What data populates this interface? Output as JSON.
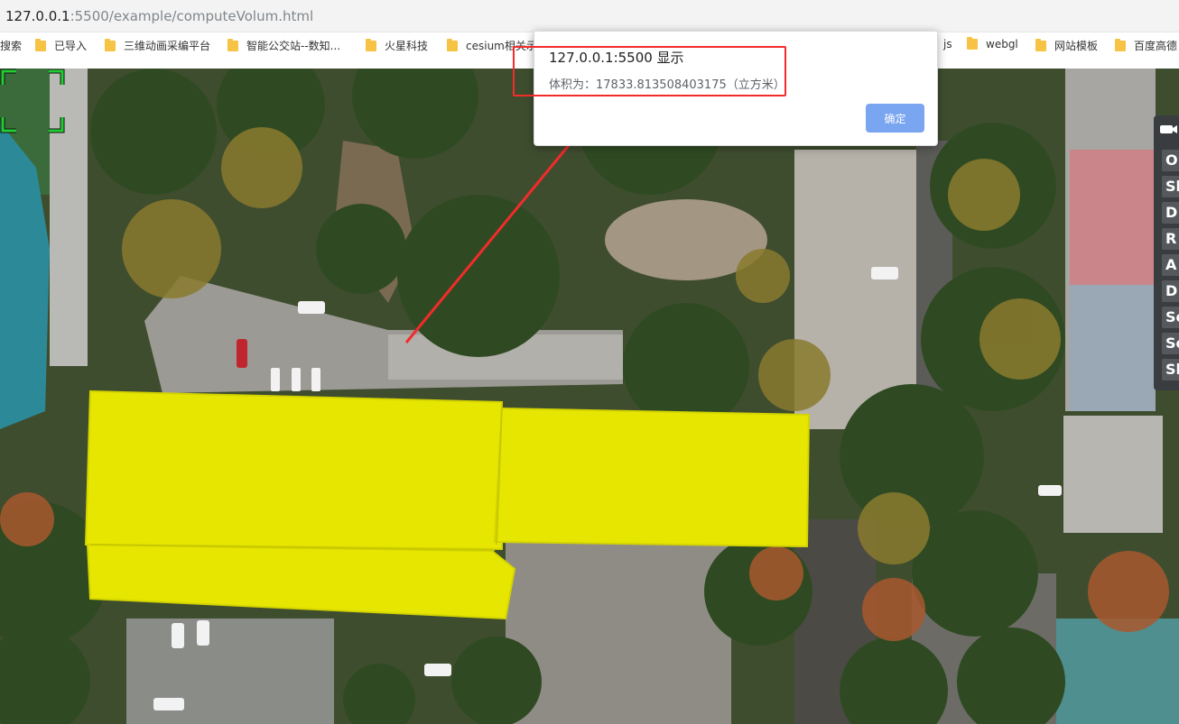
{
  "browser": {
    "url_host": "127.0.0.1",
    "url_rest": ":5500/example/computeVolum.html"
  },
  "bookmarks": [
    {
      "label": "搜索",
      "has_folder": false
    },
    {
      "label": "已导入",
      "has_folder": true
    },
    {
      "label": "三维动画采编平台",
      "has_folder": true
    },
    {
      "label": "智能公交站--数知...",
      "has_folder": true
    },
    {
      "label": "火星科技",
      "has_folder": true
    },
    {
      "label": "cesium相关示",
      "has_folder": true
    },
    {
      "label": "js",
      "has_folder": false
    },
    {
      "label": "webgl",
      "has_folder": true
    },
    {
      "label": "网站模板",
      "has_folder": true
    },
    {
      "label": "百度高德",
      "has_folder": true
    }
  ],
  "dialog": {
    "title": "127.0.0.1:5500 显示",
    "message": "体积为：17833.813508403175（立方米）",
    "ok_label": "确定"
  },
  "toolbar": {
    "items": [
      "O",
      "Sh",
      "D",
      "R",
      "A",
      "D",
      "So",
      "So",
      "Sl"
    ]
  },
  "colors": {
    "highlight": "#e6e600",
    "annotation": "#f22b2b",
    "reticle": "#22cc33",
    "ok_button": "#7aa5f0"
  }
}
